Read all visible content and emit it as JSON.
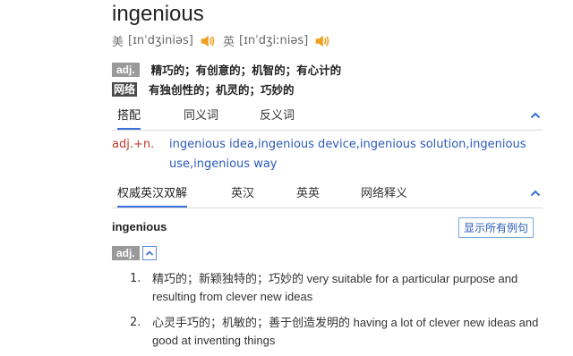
{
  "word": "ingenious",
  "pronunciations": [
    {
      "region": "美",
      "ipa": "[ɪnˈdʒiniəs]",
      "icon": "speaker-icon"
    },
    {
      "region": "英",
      "ipa": "[ɪnˈdʒiːniəs]",
      "icon": "speaker-icon"
    }
  ],
  "basic_definitions": [
    {
      "tag": "adj.",
      "text": "精巧的；有创意的；机智的；有心计的"
    },
    {
      "tag": "网络",
      "text": "有独创性的；机灵的；巧妙的"
    }
  ],
  "collocation_tabs": [
    {
      "label": "搭配",
      "active": true
    },
    {
      "label": "同义词",
      "active": false
    },
    {
      "label": "反义词",
      "active": false
    }
  ],
  "collocation": {
    "pos": "adj.+n.",
    "text": "ingenious idea,ingenious device,ingenious solution,ingenious use,ingenious way"
  },
  "dictionary_tabs": [
    {
      "label": "权威英汉双解",
      "active": true
    },
    {
      "label": "英汉",
      "active": false
    },
    {
      "label": "英英",
      "active": false
    },
    {
      "label": "网络释义",
      "active": false
    }
  ],
  "entry": {
    "headword": "ingenious",
    "show_all_label": "显示所有例句",
    "pos": "adj.",
    "senses": [
      {
        "num": "1.",
        "text": "精巧的；新颖独特的；巧妙的 very suitable for a particular purpose and resulting from clever new ideas"
      },
      {
        "num": "2.",
        "text": "心灵手巧的；机敏的；善于创造发明的 having a lot of clever new ideas and good at inventing things"
      }
    ]
  },
  "colors": {
    "accent": "#3a6fd8",
    "speaker": "#f0a020",
    "pos_red": "#c0392b",
    "link_blue": "#2a5ab8"
  }
}
